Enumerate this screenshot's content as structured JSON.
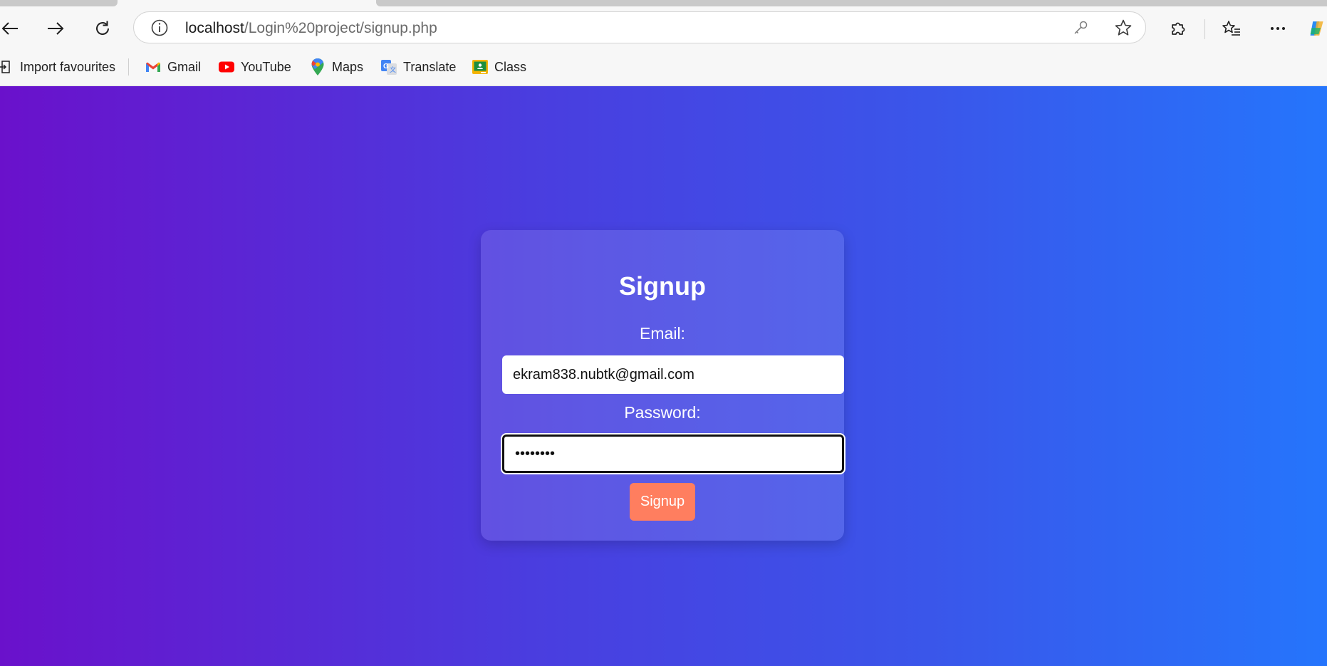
{
  "browser": {
    "url_host": "localhost",
    "url_path": "/Login%20project/signup.php",
    "bookmarks": [
      {
        "label": "Import favourites",
        "icon": "import-icon"
      },
      {
        "label": "Gmail",
        "icon": "gmail-icon"
      },
      {
        "label": "YouTube",
        "icon": "youtube-icon"
      },
      {
        "label": "Maps",
        "icon": "maps-icon"
      },
      {
        "label": "Translate",
        "icon": "translate-icon"
      },
      {
        "label": "Class",
        "icon": "classroom-icon"
      }
    ]
  },
  "form": {
    "title": "Signup",
    "email_label": "Email:",
    "email_value": "ekram838.nubtk@gmail.com",
    "password_label": "Password:",
    "password_value": "••••••••",
    "submit_label": "Signup"
  },
  "colors": {
    "gradient_start": "#6a11cb",
    "gradient_end": "#2575fc",
    "button": "#ff7e5f"
  }
}
